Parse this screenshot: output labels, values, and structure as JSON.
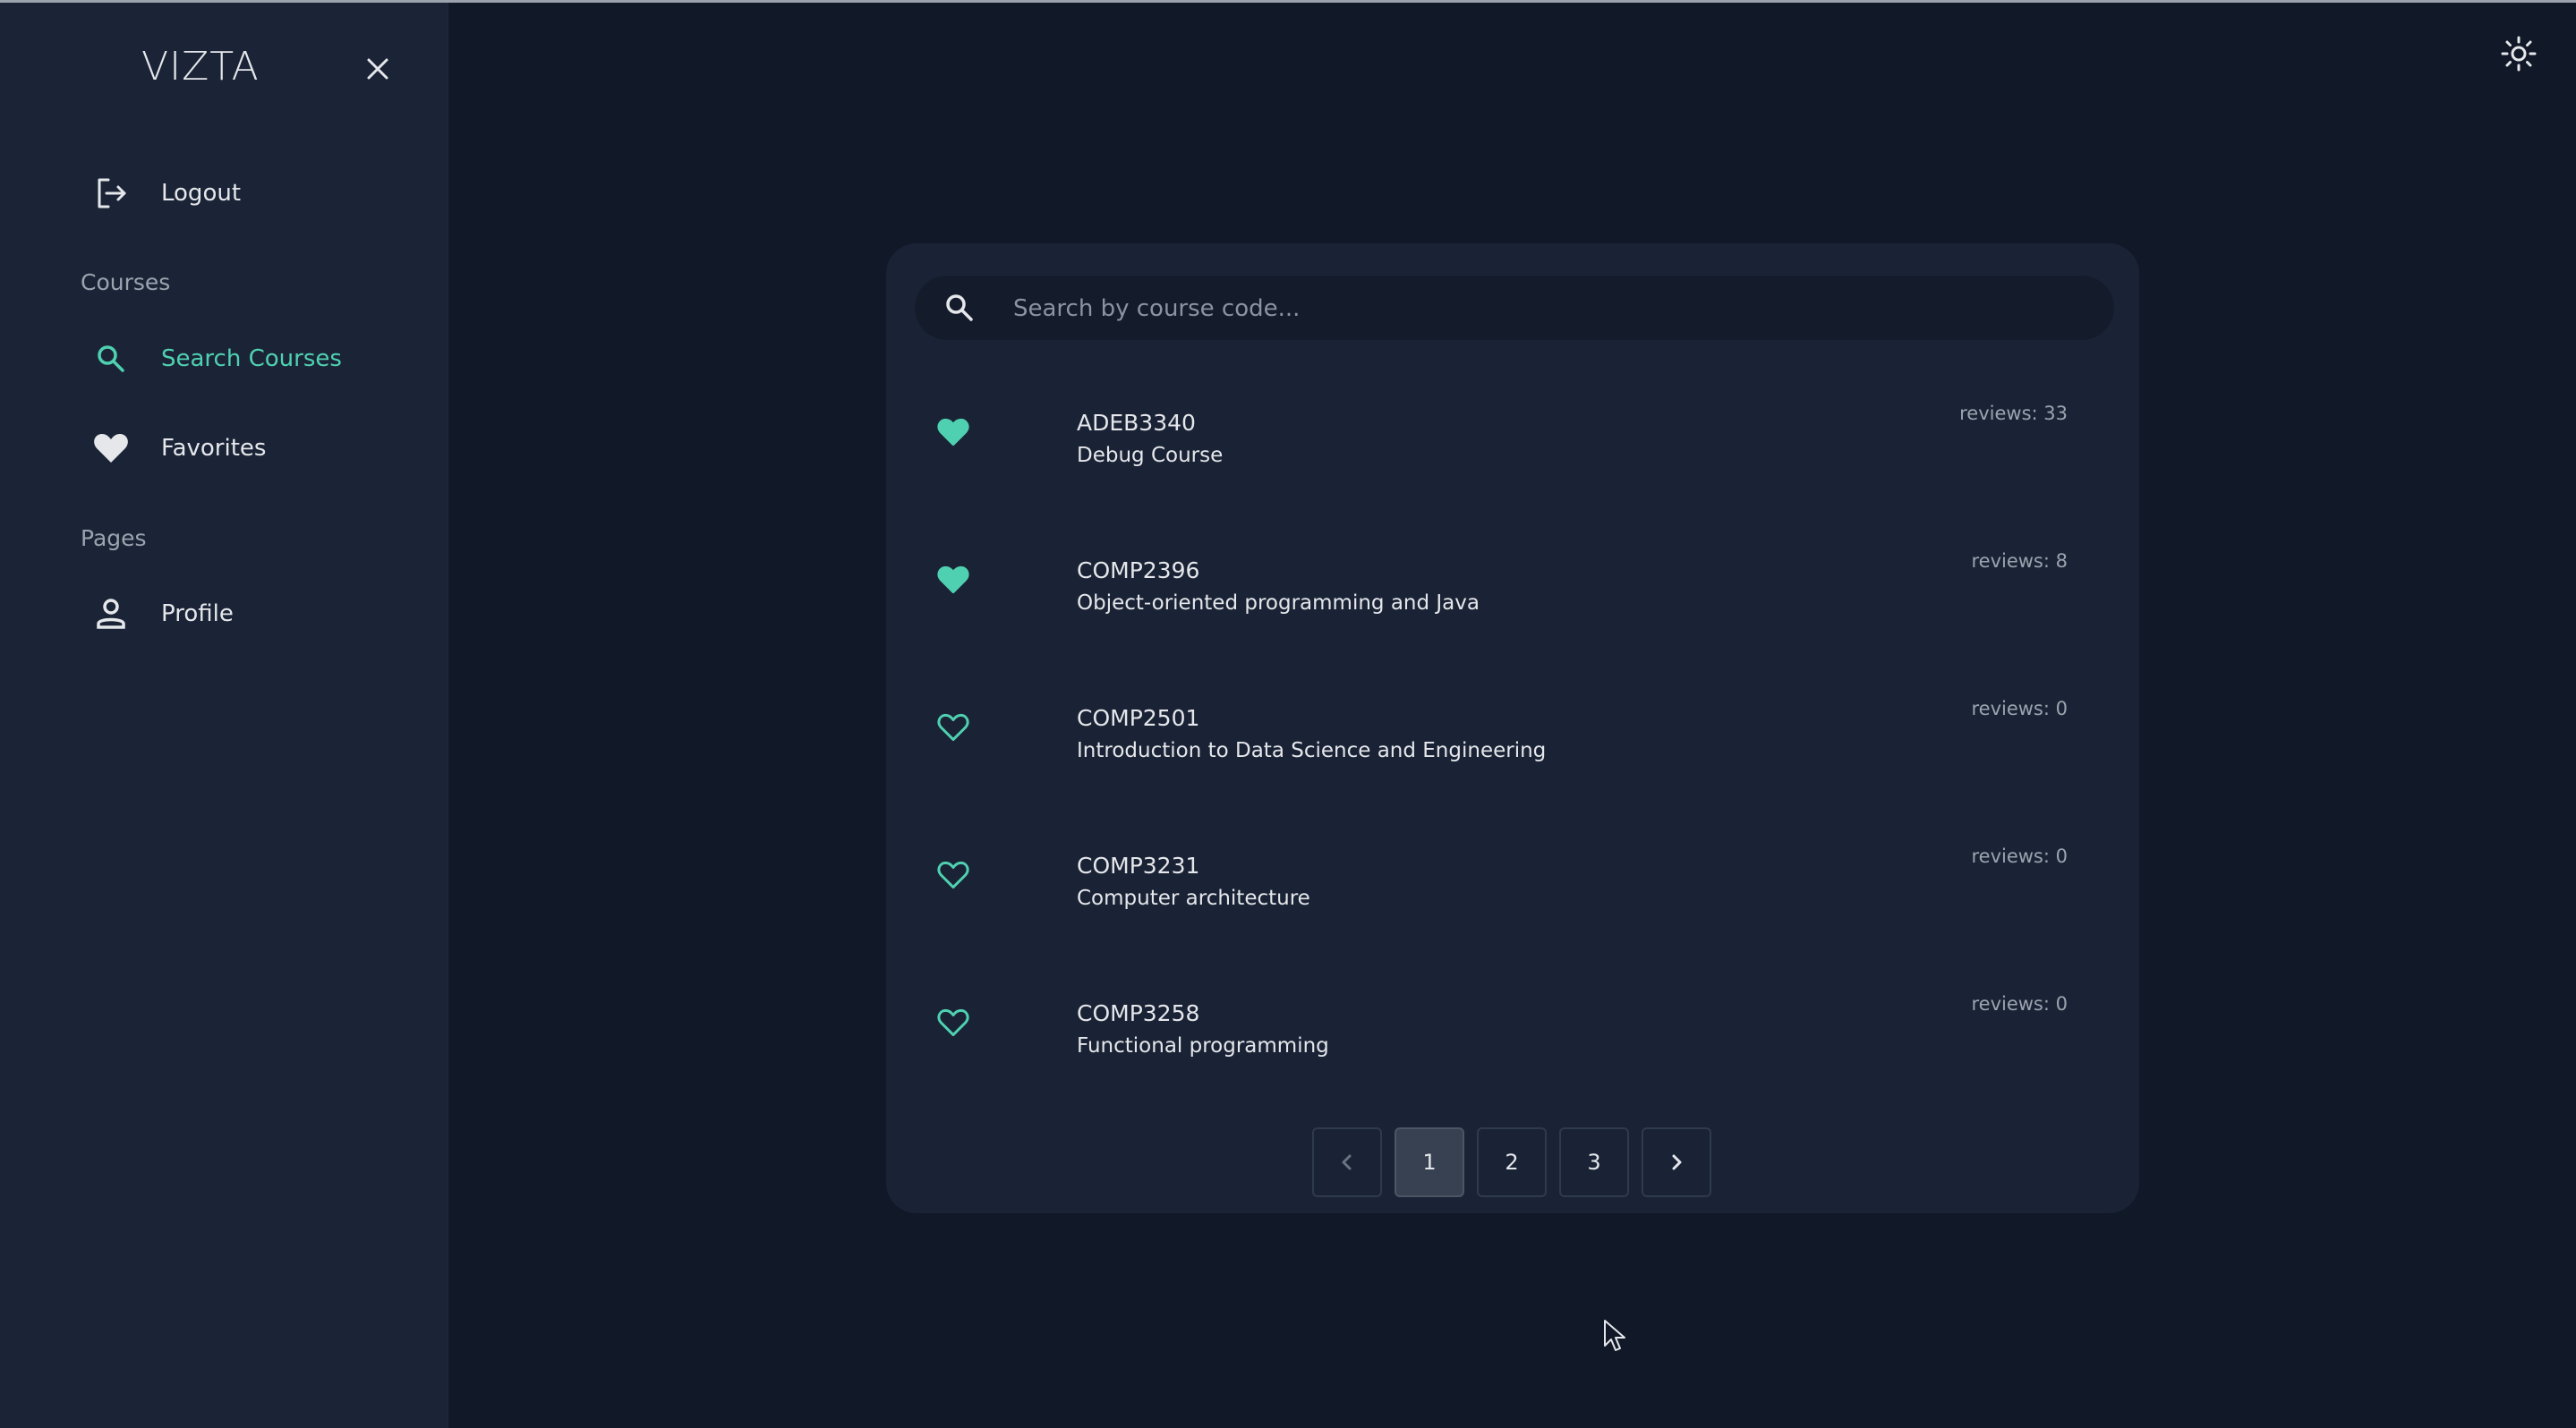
{
  "app": {
    "brand": "VIZTA"
  },
  "colors": {
    "background": "#111827",
    "sidebar": "#1b2436",
    "card": "#1a2335",
    "accent": "#4fd1b1",
    "muted": "#9ca3af"
  },
  "sidebar": {
    "close_icon": "close-icon",
    "logout": {
      "label": "Logout",
      "icon": "logout-icon"
    },
    "courses_section": "Courses",
    "search_courses": {
      "label": "Search Courses",
      "icon": "search-icon"
    },
    "favorites": {
      "label": "Favorites",
      "icon": "heart-icon"
    },
    "pages_section": "Pages",
    "profile": {
      "label": "Profile",
      "icon": "user-icon"
    }
  },
  "header": {
    "theme_toggle_icon": "sun-icon"
  },
  "search": {
    "placeholder": "Search by course code...",
    "value": ""
  },
  "courses": [
    {
      "code": "ADEB3340",
      "name": "Debug Course",
      "reviews": "reviews: 33",
      "favorited": true
    },
    {
      "code": "COMP2396",
      "name": "Object-oriented programming and Java",
      "reviews": "reviews: 8",
      "favorited": true
    },
    {
      "code": "COMP2501",
      "name": "Introduction to Data Science and Engineering",
      "reviews": "reviews: 0",
      "favorited": false
    },
    {
      "code": "COMP3231",
      "name": "Computer architecture",
      "reviews": "reviews: 0",
      "favorited": false
    },
    {
      "code": "COMP3258",
      "name": "Functional programming",
      "reviews": "reviews: 0",
      "favorited": false
    }
  ],
  "pagination": {
    "current": 1,
    "pages": [
      "1",
      "2",
      "3"
    ],
    "prev_icon": "chevron-left-icon",
    "next_icon": "chevron-right-icon"
  }
}
